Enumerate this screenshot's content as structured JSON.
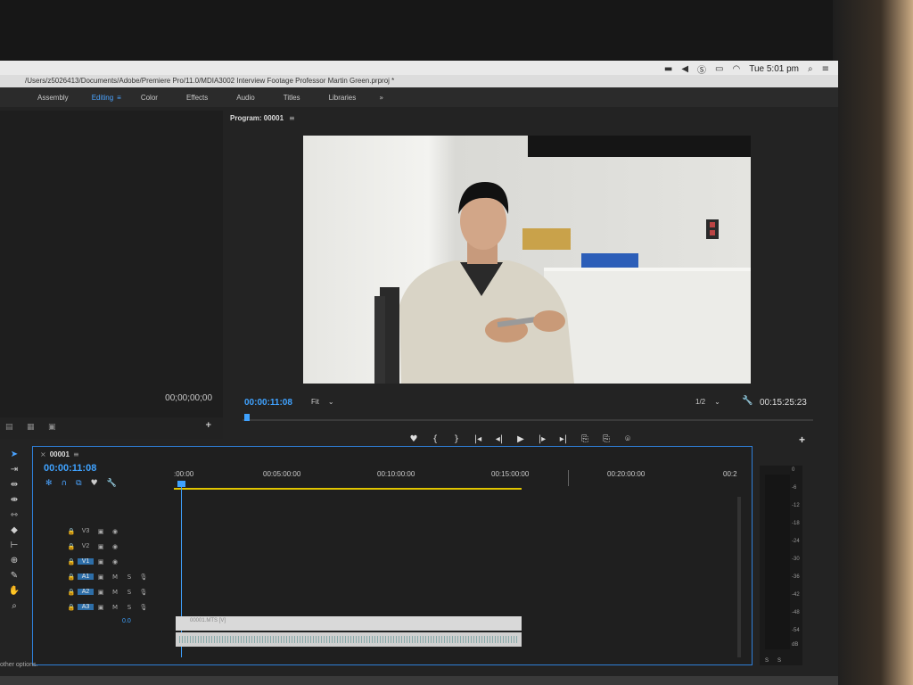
{
  "menubar": {
    "clock": "Tue 5:01 pm",
    "icons": [
      "battery-icon",
      "volume-icon",
      "skype-icon",
      "airplay-icon",
      "wifi-icon",
      "search-icon",
      "menu-icon"
    ]
  },
  "titlebar": {
    "path": "/Users/z5026413/Documents/Adobe/Premiere Pro/11.0/MDIA3002 Interview Footage Professor Martin Green.prproj *"
  },
  "workspaces": {
    "items": [
      "Assembly",
      "Editing",
      "Color",
      "Effects",
      "Audio",
      "Titles",
      "Libraries"
    ],
    "active": "Editing",
    "more": "»"
  },
  "source": {
    "timecode": "00;00;00;00"
  },
  "program": {
    "title": "Program: 00001",
    "current_tc": "00:00:11:08",
    "fit": "Fit",
    "resolution": "1/2",
    "duration_tc": "00:15:25:23"
  },
  "transport": [
    "♥",
    "{",
    "}",
    "|◂",
    "◂|",
    "▶",
    "|▸",
    "▸|",
    "⎘",
    "⎘",
    "⌾"
  ],
  "timeline": {
    "name": "00001",
    "timecode": "00:00:11:08",
    "ruler": [
      ":00:00",
      "00:05:00:00",
      "00:10:00:00",
      "00:15:00:00",
      "00:20:00:00",
      "00:2"
    ],
    "tracks": [
      {
        "name": "V3",
        "kind": "video"
      },
      {
        "name": "V2",
        "kind": "video"
      },
      {
        "name": "V1",
        "kind": "video"
      },
      {
        "name": "A1",
        "kind": "audio"
      },
      {
        "name": "A2",
        "kind": "audio"
      },
      {
        "name": "A3",
        "kind": "audio"
      }
    ],
    "volume": "0.0",
    "clip_label": "00001.MTS [V]"
  },
  "meter": {
    "levels": [
      "0",
      "-6",
      "-12",
      "-18",
      "-24",
      "-30",
      "-36",
      "-42",
      "-48",
      "-54",
      "dB"
    ],
    "channels": [
      "S",
      "S"
    ]
  },
  "status": "other options."
}
